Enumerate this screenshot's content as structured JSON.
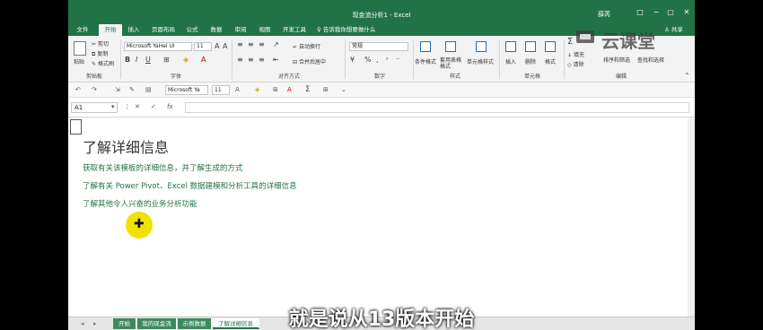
{
  "window": {
    "title": "现金流分析1 - Excel",
    "user": "薛芮",
    "controls": {
      "options": "□",
      "minimize": "−",
      "maximize": "▢",
      "close": "✕"
    }
  },
  "ribbon_tabs": [
    "文件",
    "开始",
    "插入",
    "页面布局",
    "公式",
    "数据",
    "审阅",
    "视图",
    "开发工具"
  ],
  "active_tab": "开始",
  "tell_me": "告诉我你想要做什么",
  "share": "共享",
  "ribbon": {
    "clipboard": {
      "label": "剪贴板",
      "paste": "粘贴",
      "cut": "剪切",
      "copy": "复制",
      "format_painter": "格式刷"
    },
    "font": {
      "label": "字体",
      "name": "Microsoft YaHei UI",
      "size": "11",
      "bold": "B",
      "italic": "I",
      "underline": "U"
    },
    "alignment": {
      "label": "对齐方式",
      "wrap": "自动换行",
      "merge": "合并后居中"
    },
    "number": {
      "label": "数字",
      "format": "常规"
    },
    "styles": {
      "label": "样式",
      "conditional": "条件格式",
      "table": "套用表格格式",
      "cell_styles": "单元格样式"
    },
    "cells": {
      "label": "单元格",
      "insert": "插入",
      "delete": "删除",
      "format": "格式"
    },
    "editing": {
      "label": "编辑",
      "fill": "填充",
      "clear": "清除",
      "sort": "排序和筛选",
      "find": "查找和选择"
    }
  },
  "qat": {
    "font_name": "Microsoft Ya",
    "font_size": "11"
  },
  "formula_bar": {
    "name_box": "A1",
    "fx": "fx"
  },
  "content": {
    "heading": "了解详细信息",
    "links": [
      "获取有关该模板的详细信息，并了解生成的方式",
      "了解有关 Power Pivot、Excel 数据建模和分析工具的详细信息",
      "了解其他令人兴奋的业务分析功能"
    ]
  },
  "sheet_tabs": [
    "开始",
    "我的现金流",
    "示例数据",
    "了解详细信息"
  ],
  "active_sheet": "了解详细信息",
  "watermark": "云课堂",
  "subtitle": "就是说从13版本开始",
  "colors": {
    "excel_green": "#217346",
    "link_green": "#217346",
    "cursor_yellow": "#f2e200"
  }
}
